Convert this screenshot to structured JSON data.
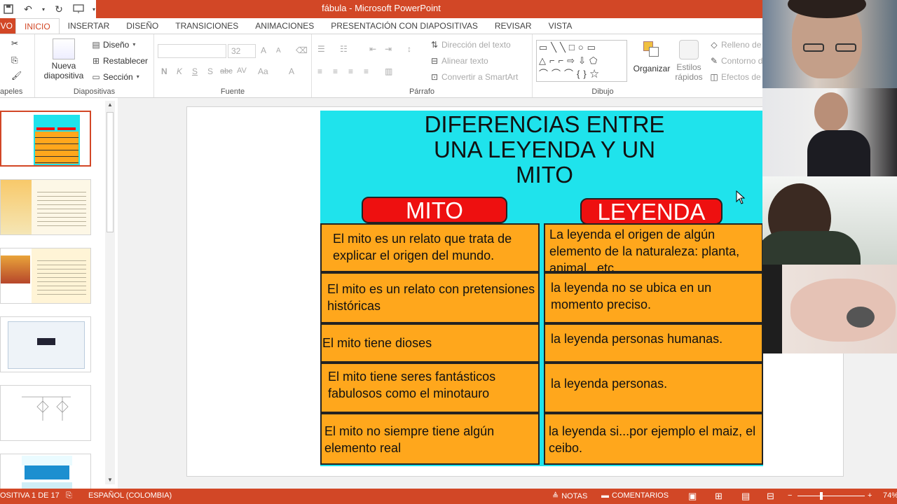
{
  "window": {
    "title": "fábula -  Microsoft PowerPoint"
  },
  "quick_access": [
    {
      "name": "save-icon",
      "glyph": "🖫"
    },
    {
      "name": "undo-icon",
      "glyph": "↶"
    },
    {
      "name": "repeat-icon",
      "glyph": "↻"
    },
    {
      "name": "presentation-icon",
      "glyph": "⌨"
    }
  ],
  "tabs": {
    "file": "IVO",
    "items": [
      "INICIO",
      "INSERTAR",
      "DISEÑO",
      "TRANSICIONES",
      "ANIMACIONES",
      "PRESENTACIÓN CON DIAPOSITIVAS",
      "REVISAR",
      "VISTA"
    ],
    "active_index": 0
  },
  "ribbon": {
    "clipboard": {
      "label": "apeles"
    },
    "slides": {
      "label": "Diapositivas",
      "new_slide": "Nueva",
      "new_slide_2": "diapositiva",
      "layout": "Diseño",
      "reset": "Restablecer",
      "section": "Sección"
    },
    "font": {
      "label": "Fuente",
      "size": "32",
      "bold": "N",
      "italic": "K",
      "underline": "S",
      "shadow": "S",
      "strike": "abc",
      "spacing": "AV",
      "case": "Aa",
      "color": "A",
      "grow": "A",
      "shrink": "A"
    },
    "paragraph": {
      "label": "Párrafo",
      "text_direction": "Dirección del texto",
      "align_text": "Alinear texto",
      "smartart": "Convertir a SmartArt"
    },
    "drawing": {
      "label": "Dibujo",
      "arrange": "Organizar",
      "quick_styles_1": "Estilos",
      "quick_styles_2": "rápidos",
      "fill": "Relleno de",
      "outline": "Contorno d",
      "effects": "Efectos de"
    }
  },
  "slide": {
    "title_line1": "DIFERENCIAS ENTRE",
    "title_line2": "UNA LEYENDA Y UN",
    "title_line3": "MITO",
    "col_mito": "MITO",
    "col_leyenda": "LEYENDA",
    "rows": [
      {
        "mito": "El mito es un relato que trata de explicar el origen del mundo.",
        "leyenda": "La leyenda el origen de algún elemento de la naturaleza: planta, animal...etc"
      },
      {
        "mito": "El mito es un relato con pretensiones históricas",
        "leyenda": "la leyenda no se ubica en un momento preciso."
      },
      {
        "mito": "El mito tiene dioses",
        "leyenda": "la leyenda personas humanas."
      },
      {
        "mito": "El mito tiene seres fantásticos fabulosos como el minotauro",
        "leyenda": "la leyenda personas."
      },
      {
        "mito": "El mito no siempre tiene algún elemento real",
        "leyenda": "la leyenda si...por ejemplo el maiz, el ceibo."
      }
    ]
  },
  "status": {
    "slide_counter": "OSITIVA 1 DE 17",
    "language": "ESPAÑOL (COLOMBIA)",
    "notes": "NOTAS",
    "comments": "COMENTARIOS",
    "zoom": "74%"
  },
  "colors": {
    "accent": "#d24726",
    "slide_bg": "#1fe3ec",
    "cell": "#ffa71c",
    "pill": "#ee1010"
  }
}
